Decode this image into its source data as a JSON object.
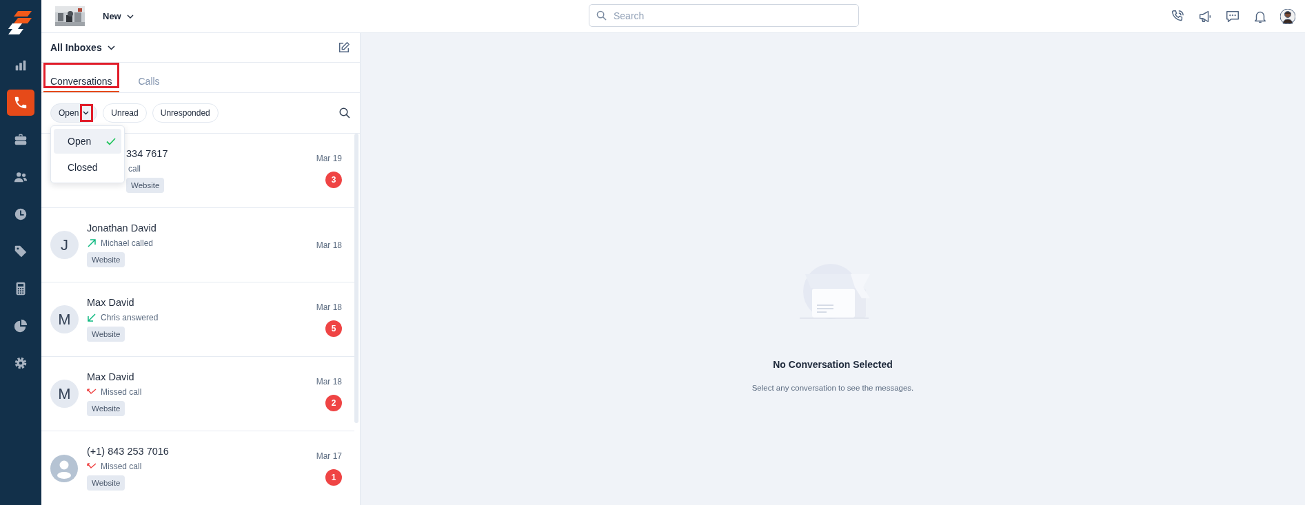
{
  "topbar": {
    "menu": "New",
    "search": {
      "placeholder": "Search"
    }
  },
  "nav": [
    {
      "selected": false
    },
    {
      "selected": true
    },
    {
      "selected": false
    },
    {
      "selected": false
    },
    {
      "selected": false
    },
    {
      "selected": false
    },
    {
      "selected": false
    },
    {
      "selected": false
    },
    {
      "selected": false
    }
  ],
  "inbox": {
    "title": "All Inboxes",
    "tabs": [
      {
        "label": "Conversations",
        "selected": true,
        "highlighted": true
      },
      {
        "label": "Calls",
        "selected": false,
        "highlighted": false
      }
    ],
    "filters": [
      {
        "label": "Open",
        "selected": true,
        "dropdown": true,
        "highlighted": true
      },
      {
        "label": "Unread",
        "selected": false,
        "dropdown": false,
        "highlighted": false
      },
      {
        "label": "Unresponded",
        "selected": false,
        "dropdown": false,
        "highlighted": false
      }
    ],
    "dropdown": {
      "options": [
        {
          "label": "Open",
          "selected": true
        },
        {
          "label": "Closed",
          "selected": false
        }
      ]
    },
    "conversations": [
      {
        "kind": "covered",
        "name": "334 7617",
        "summary": {
          "text": "call"
        },
        "tag": "Website",
        "date": "Mar 19",
        "unread": "3"
      },
      {
        "kind": "contact",
        "avatar": "J",
        "name": "Jonathan David",
        "summary": {
          "kind": "outgoing",
          "text": "Michael called"
        },
        "tag": "Website",
        "date": "Mar 18"
      },
      {
        "kind": "contact",
        "avatar": "M",
        "name": "Max David",
        "summary": {
          "kind": "incoming",
          "text": "Chris answered"
        },
        "tag": "Website",
        "date": "Mar 18",
        "unread": "5"
      },
      {
        "kind": "contact",
        "avatar": "M",
        "name": "Max David",
        "summary": {
          "kind": "missed",
          "text": "Missed call"
        },
        "tag": "Website",
        "date": "Mar 18",
        "unread": "2"
      },
      {
        "kind": "unknown",
        "name": "(+1) 843 253 7016",
        "summary": {
          "kind": "missed",
          "text": "Missed call"
        },
        "tag": "Website",
        "date": "Mar 17",
        "unread": "1"
      }
    ]
  },
  "empty_state": {
    "title": "No Conversation Selected",
    "message": "Select any conversation to see the messages."
  }
}
